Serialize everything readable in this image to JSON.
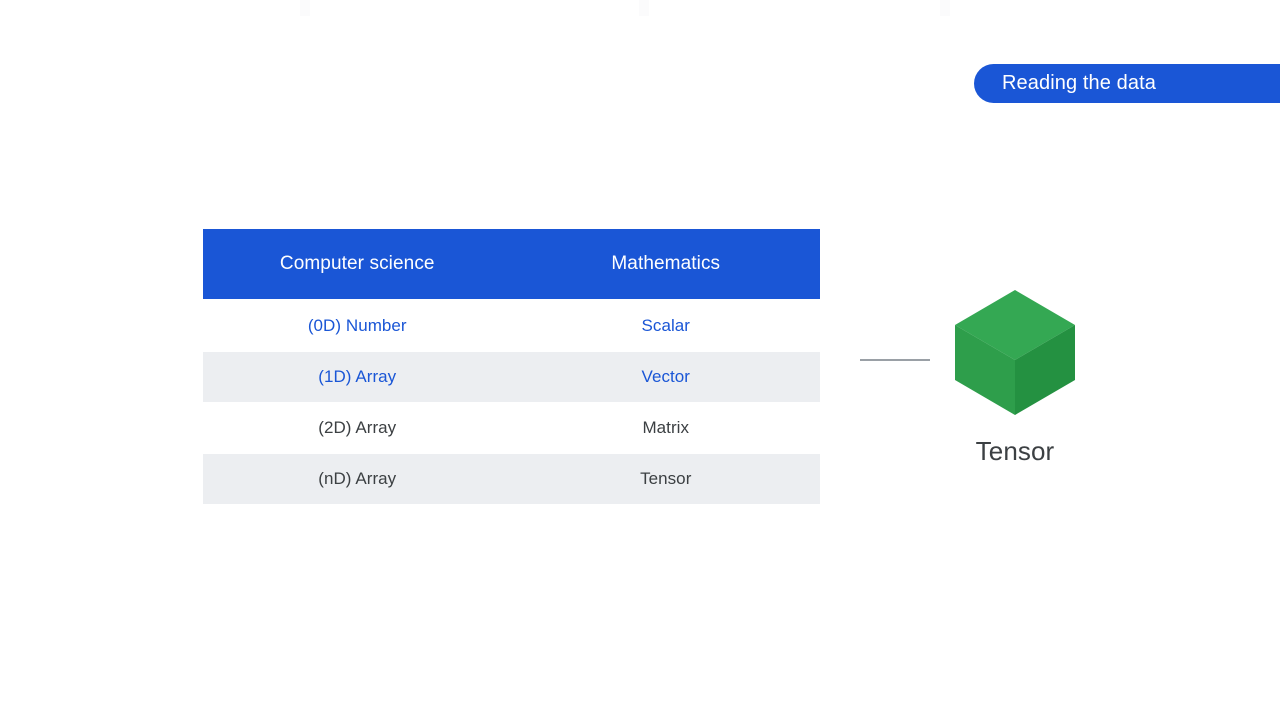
{
  "slide": {
    "background": "#ffffff",
    "top_marks": [
      "mark-1",
      "mark-2",
      "mark-3"
    ]
  },
  "banner": {
    "label": "Reading the data",
    "color": "#1a56d6",
    "text_color": "#ffffff"
  },
  "table": {
    "header": {
      "background": "#1a56d6",
      "text_color": "#ffffff",
      "columns": [
        "Computer science",
        "Mathematics"
      ]
    },
    "accent_color": "#1a56d6",
    "neutral_color": "#3c4043",
    "shaded_row_color": "#eceef1",
    "plain_row_color": "#ffffff",
    "rows": [
      {
        "cs": "(0D) Number",
        "math": "Scalar",
        "style": "accent",
        "band": "plain"
      },
      {
        "cs": "(1D) Array",
        "math": "Vector",
        "style": "accent",
        "band": "shaded"
      },
      {
        "cs": "(2D) Array",
        "math": "Matrix",
        "style": "neutral",
        "band": "plain"
      },
      {
        "cs": "(nD) Array",
        "math": "Tensor",
        "style": "neutral",
        "band": "shaded"
      }
    ]
  },
  "connector": {
    "name": "connector-line",
    "color": "#9aa0a6"
  },
  "tensor": {
    "label": "Tensor",
    "label_color": "#3c4043",
    "icon": "green-cube-icon",
    "face_colors": {
      "top": "#34a853",
      "left": "#2e9e4b",
      "right": "#249141"
    }
  }
}
